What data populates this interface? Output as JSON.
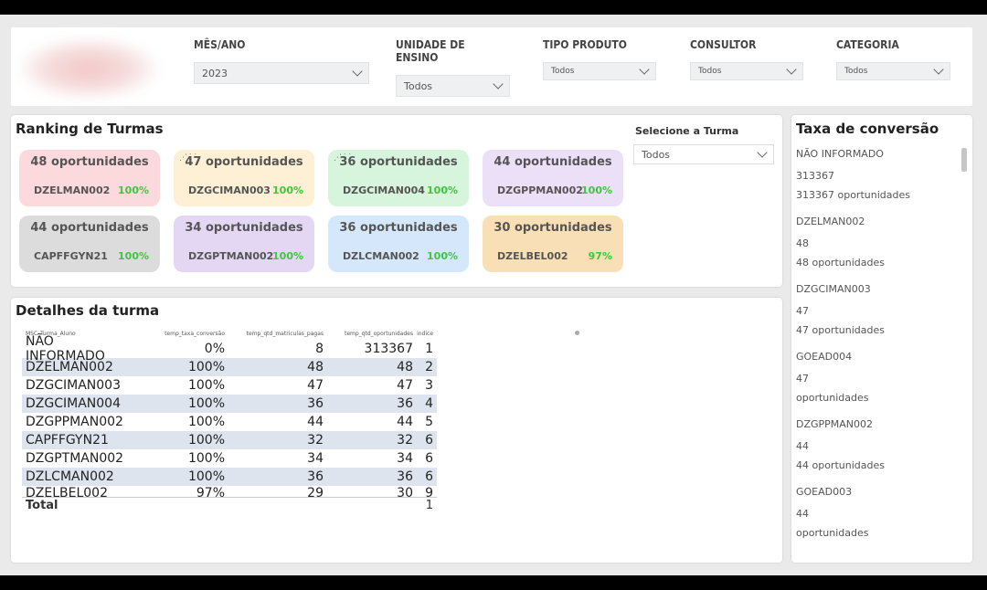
{
  "filters": [
    {
      "label": "MÊS/ANO",
      "value": "2023"
    },
    {
      "label": "UNIDADE DE ENSINO",
      "value": "Todos"
    },
    {
      "label": "TIPO PRODUTO",
      "value": "Todos"
    },
    {
      "label": "CONSULTOR",
      "value": "Todos"
    },
    {
      "label": "CATEGORIA",
      "value": "Todos"
    }
  ],
  "ranking": {
    "title": "Ranking de Turmas",
    "select_label": "Selecione a Turma",
    "select_value": "Todos",
    "cards": [
      {
        "count": "48 oportunidades",
        "code": "DZELMAN002",
        "pct": "100%",
        "color": "#fcd9dc"
      },
      {
        "count": "47 oportunidades",
        "code": "DZGCIMAN003",
        "pct": "100%",
        "color": "#fdf0d5"
      },
      {
        "count": "36 oportunidades",
        "code": "DZGCIMAN004",
        "pct": "100%",
        "color": "#d6f5dc"
      },
      {
        "count": "44 oportunidades",
        "code": "DZGPPMAN002",
        "pct": "100%",
        "color": "#ecdff8"
      },
      {
        "count": "44 oportunidades",
        "code": "CAPFFGYN21",
        "pct": "100%",
        "color": "#dcdcdc"
      },
      {
        "count": "34 oportunidades",
        "code": "DZGPTMAN002",
        "pct": "100%",
        "color": "#e3d7f3"
      },
      {
        "count": "36 oportunidades",
        "code": "DZLCMAN002",
        "pct": "100%",
        "color": "#d5e7fa"
      },
      {
        "count": "30 oportunidades",
        "code": "DZELBEL002",
        "pct": "97%",
        "color": "#f8dfb5"
      }
    ]
  },
  "details": {
    "title": "Detalhes da turma",
    "columns": [
      "MSC_Turma_Aluno",
      "temp_taxa_conversão",
      "temp_qtd_matriculas_pagas",
      "temp_qtd_oportunidades",
      "indice"
    ],
    "rows": [
      [
        "NÃO INFORMADO",
        "0%",
        "8",
        "313367",
        "1"
      ],
      [
        "DZELMAN002",
        "100%",
        "48",
        "48",
        "2"
      ],
      [
        "DZGCIMAN003",
        "100%",
        "47",
        "47",
        "3"
      ],
      [
        "DZGCIMAN004",
        "100%",
        "36",
        "36",
        "4"
      ],
      [
        "DZGPPMAN002",
        "100%",
        "44",
        "44",
        "5"
      ],
      [
        "CAPFFGYN21",
        "100%",
        "32",
        "32",
        "6"
      ],
      [
        "DZGPTMAN002",
        "100%",
        "34",
        "34",
        "6"
      ],
      [
        "DZLCMAN002",
        "100%",
        "36",
        "36",
        "6"
      ],
      [
        "DZELBEL002",
        "97%",
        "29",
        "30",
        "9"
      ]
    ],
    "total_label": "Total",
    "total_indice": "1"
  },
  "conversion": {
    "title": "Taxa de conversão",
    "items": [
      [
        "NÃO INFORMADO",
        "313367",
        "313367 oportunidades"
      ],
      [
        "DZELMAN002",
        "48",
        "48 oportunidades"
      ],
      [
        "DZGCIMAN003",
        "47",
        "47 oportunidades"
      ],
      [
        "GOEAD004",
        "47",
        "oportunidades"
      ],
      [
        "DZGPPMAN002",
        "44",
        "44 oportunidades"
      ],
      [
        "GOEAD003",
        "44",
        "oportunidades"
      ]
    ]
  }
}
